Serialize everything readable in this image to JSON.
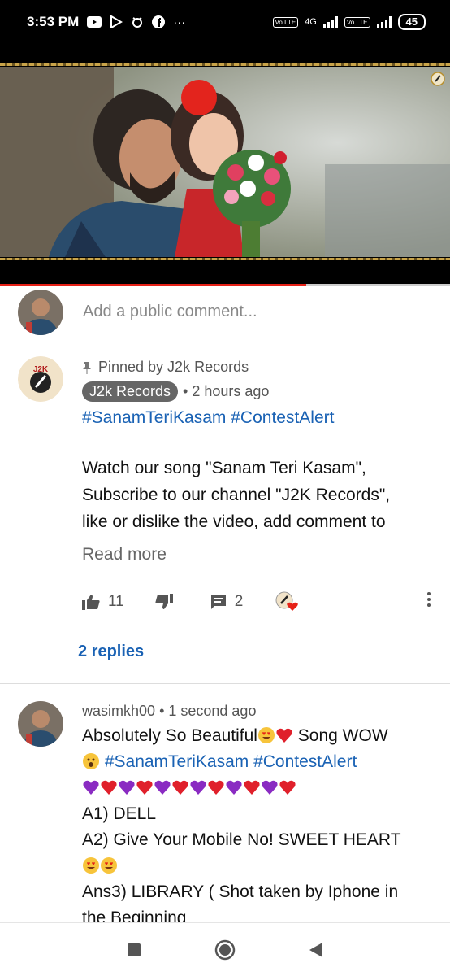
{
  "status_bar": {
    "time": "3:53 PM",
    "notification_icons": [
      "youtube-icon",
      "play-store-icon",
      "bug-icon",
      "facebook-icon"
    ],
    "more_indicator": "···",
    "network_label": "4G",
    "lte_label_1": "Vo LTE",
    "lte_label_2": "Vo LTE",
    "battery": "45"
  },
  "video": {
    "progress": 0.68,
    "channel_watermark": "j2k-logo-icon",
    "progress_color": "#e62117"
  },
  "add_comment": {
    "placeholder": "Add a public comment..."
  },
  "pinned_comment": {
    "pinned_label": "Pinned by J2k Records",
    "author": "J2k Records",
    "time": "• 2 hours ago",
    "hashtags": "#SanamTeriKasam #ContestAlert",
    "text_lines": [
      "Watch our song \"Sanam Teri Kasam\",",
      "Subscribe to our channel \"J2K Records\",",
      "like or dislike the video, add comment to"
    ],
    "read_more": "Read more",
    "likes": "11",
    "reply_count": "2",
    "replies_link": "2 replies",
    "avatar_text": "J2K"
  },
  "user_comment": {
    "author": "wasimkh00",
    "time": "• 1 second ago",
    "line1_a": "Absolutely So Beautiful",
    "line1_b": " Song WOW",
    "line2_tags": " #SanamTeriKasam #ContestAlert",
    "line4": "A1) DELL",
    "line5": "A2) Give Your Mobile No! SWEET HEART",
    "line7": "Ans3) LIBRARY ( Shot taken by Iphone in",
    "line8": "the Beginning"
  },
  "colors": {
    "link": "#1a62b4",
    "accent_red": "#e62117"
  }
}
